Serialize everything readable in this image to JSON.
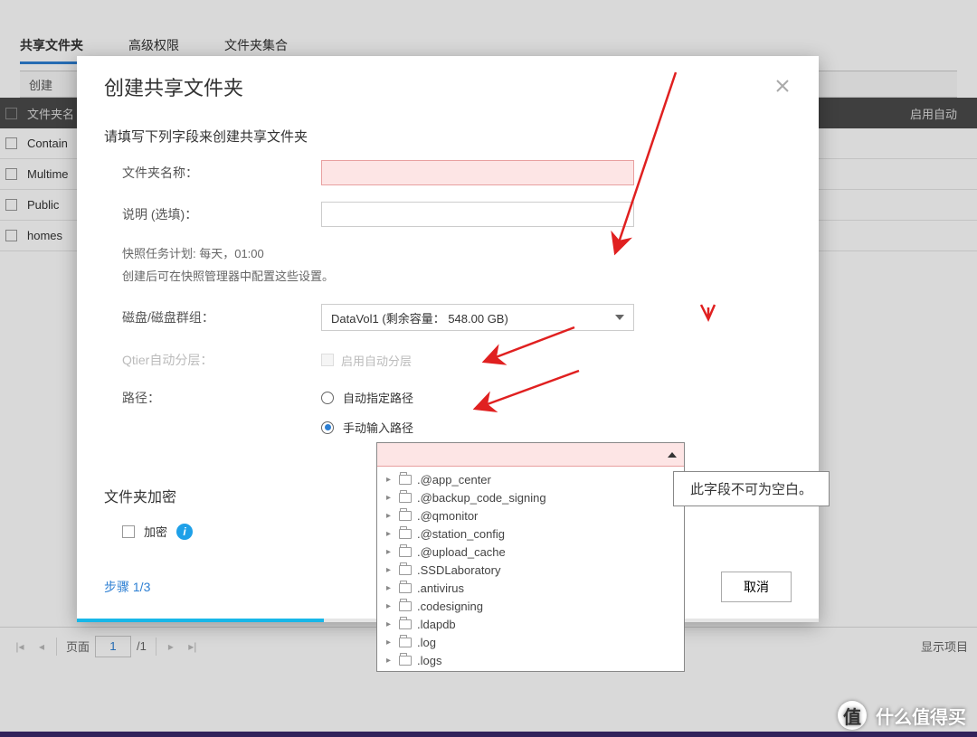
{
  "bgTabs": [
    "共享文件夹",
    "高级权限",
    "文件夹集合"
  ],
  "bgToolbar": {
    "create": "创建"
  },
  "bgTable": {
    "headerName": "文件夹名",
    "headerLast": "启用自动",
    "rows": [
      "Contain",
      "Multime",
      "Public",
      "homes"
    ]
  },
  "pager": {
    "label": "页面",
    "value": "1",
    "total": "/1",
    "right": "显示项目"
  },
  "dialog": {
    "title": "创建共享文件夹",
    "sectionTitle": "请填写下列字段来创建共享文件夹",
    "labels": {
      "folderName": "文件夹名称：",
      "desc": "说明 (选填)：",
      "snapshotLine1": "快照任务计划: 每天，01:00",
      "snapshotLine2": "创建后可在快照管理器中配置这些设置。",
      "disk": "磁盘/磁盘群组：",
      "qtier": "Qtier自动分层：",
      "qtierCheck": "启用自动分层",
      "path": "路径：",
      "pathAuto": "自动指定路径",
      "pathManual": "手动输入路径",
      "encryptTitle": "文件夹加密",
      "encrypt": "加密"
    },
    "diskValue": "DataVol1 (剩余容量： 548.00 GB)",
    "step": "步骤 1/3",
    "cancel": "取消"
  },
  "pathTree": [
    ".@app_center",
    ".@backup_code_signing",
    ".@qmonitor",
    ".@station_config",
    ".@upload_cache",
    ".SSDLaboratory",
    ".antivirus",
    ".codesigning",
    ".ldapdb",
    ".log",
    ".logs"
  ],
  "tooltip": "此字段不可为空白。",
  "watermark": "什么值得买"
}
